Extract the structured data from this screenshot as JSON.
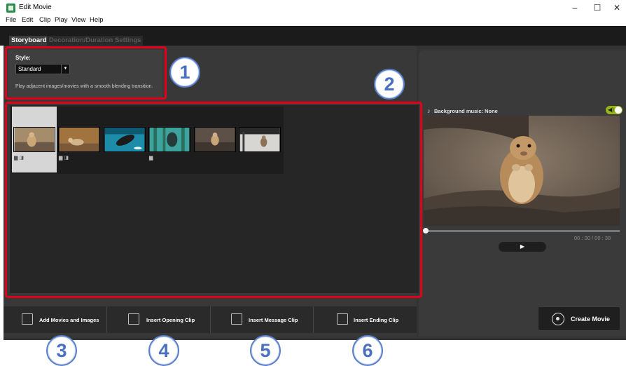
{
  "window": {
    "title": "Edit Movie",
    "controls": {
      "minimize": "–",
      "maximize": "☐",
      "close": "✕"
    }
  },
  "menu": [
    "File",
    "Edit",
    "Clip",
    "Play",
    "View",
    "Help"
  ],
  "tabs": [
    {
      "label": "Storyboard",
      "active": true
    },
    {
      "label": "Decoration/Duration Settings",
      "active": false
    }
  ],
  "style_panel": {
    "label": "Style:",
    "selected": "Standard",
    "description": "Play adjacent images/movies with a smooth blending transition."
  },
  "storyboard": {
    "clips": [
      {
        "selected": true,
        "badges": "▆◨"
      },
      {
        "selected": false,
        "badges": "▆◨"
      },
      {
        "selected": false,
        "badges": ""
      },
      {
        "selected": false,
        "badges": "▆"
      },
      {
        "selected": false,
        "badges": ""
      },
      {
        "selected": false,
        "badges": ""
      }
    ]
  },
  "bottom_buttons": [
    {
      "label": "Add Movies and Images"
    },
    {
      "label": "Insert Opening Clip"
    },
    {
      "label": "Insert Message Clip"
    },
    {
      "label": "Insert Ending Clip"
    }
  ],
  "preview": {
    "music_icon": "♪",
    "music_label": "Background music: None",
    "time": "00 : 00  /  00 : 38",
    "play_symbol": "▶",
    "speaker_symbol": "◀)"
  },
  "create_movie": {
    "label": "Create Movie"
  },
  "callouts": [
    "1",
    "2",
    "3",
    "4",
    "5",
    "6"
  ],
  "colors": {
    "highlight": "#e0001a",
    "callout": "#4a70c0",
    "toggle": "#9ab41a"
  }
}
